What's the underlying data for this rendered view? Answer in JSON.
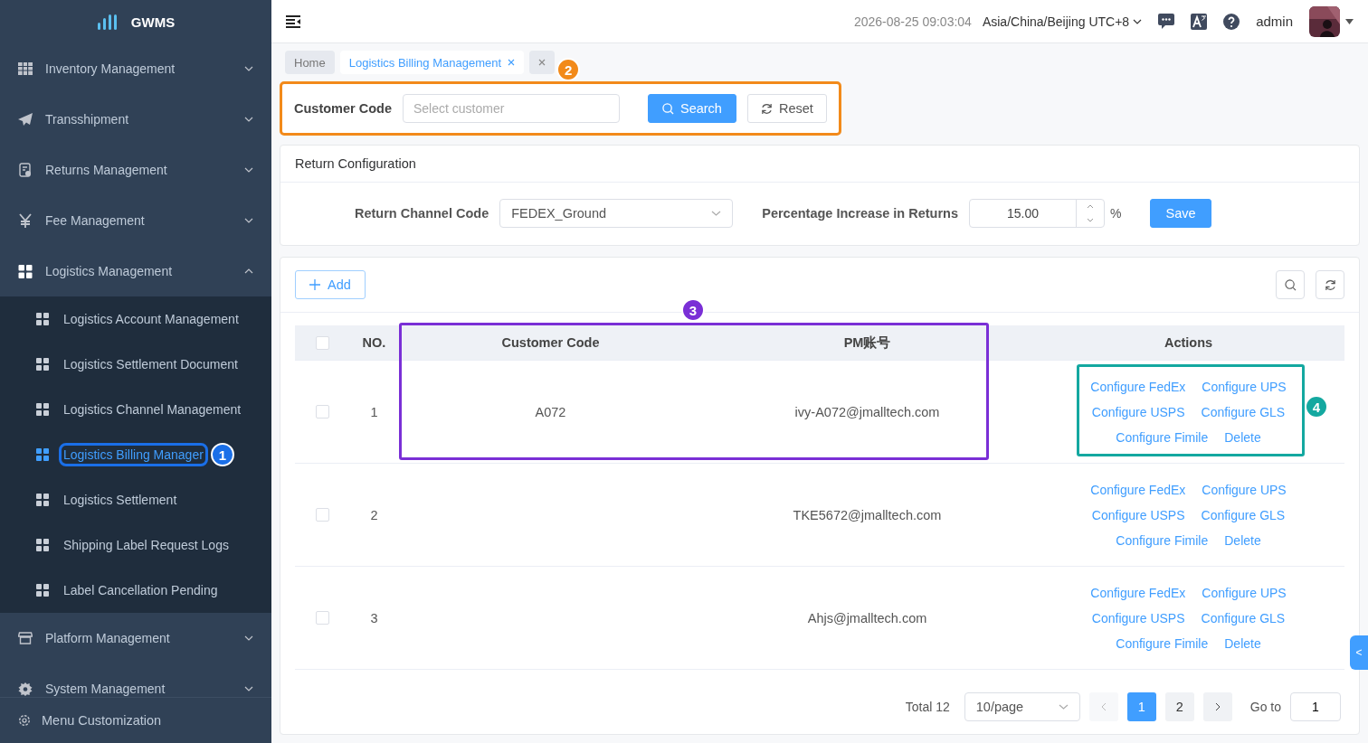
{
  "sidebar": {
    "logo": "GWMS",
    "items": [
      {
        "label": "Inventory Management",
        "expanded": false
      },
      {
        "label": "Transshipment",
        "expanded": false
      },
      {
        "label": "Returns Management",
        "expanded": false
      },
      {
        "label": "Fee Management",
        "expanded": false
      },
      {
        "label": "Logistics Management",
        "expanded": true,
        "children": [
          {
            "label": "Logistics Account Management",
            "selected": false
          },
          {
            "label": "Logistics Settlement Document",
            "selected": false
          },
          {
            "label": "Logistics Channel Management",
            "selected": false
          },
          {
            "label": "Logistics Billing Manager",
            "selected": true
          },
          {
            "label": "Logistics Settlement",
            "selected": false
          },
          {
            "label": "Shipping Label Request Logs",
            "selected": false
          },
          {
            "label": "Label Cancellation Pending",
            "selected": false
          }
        ]
      },
      {
        "label": "Platform Management",
        "expanded": false
      },
      {
        "label": "System Management",
        "expanded": false
      }
    ],
    "footer": "Menu Customization"
  },
  "header": {
    "datetime": "2026-08-25 09:03:04",
    "timezone": "Asia/China/Beijing UTC+8",
    "user": "admin"
  },
  "tabs": [
    {
      "label": "Home",
      "selected": false,
      "closable": false
    },
    {
      "label": "Logistics Billing Management",
      "selected": true,
      "closable": true
    },
    {
      "selected": false,
      "closable": true
    }
  ],
  "filter": {
    "label": "Customer Code",
    "placeholder": "Select customer",
    "search": "Search",
    "reset": "Reset"
  },
  "return_config": {
    "title": "Return Configuration",
    "channel_label": "Return Channel Code",
    "channel_value": "FEDEX_Ground",
    "percent_label": "Percentage Increase in Returns",
    "percent_value": "15.00",
    "unit": "%",
    "save": "Save"
  },
  "toolbar": {
    "add": "Add"
  },
  "table": {
    "all_checked": false,
    "columns": [
      "NO.",
      "Customer Code",
      "PM账号",
      "Actions"
    ],
    "rows": [
      {
        "checked": false,
        "no": "1",
        "customer_code": "A072",
        "pm_account": "ivy-A072@jmalltech.com",
        "actions": [
          "Configure FedEx",
          "Configure UPS",
          "Configure USPS",
          "Configure GLS",
          "Configure Fimile",
          "Delete"
        ]
      },
      {
        "checked": false,
        "no": "2",
        "pm_account": "TKE5672@jmalltech.com",
        "actions": [
          "Configure FedEx",
          "Configure UPS",
          "Configure USPS",
          "Configure GLS",
          "Configure Fimile",
          "Delete"
        ]
      },
      {
        "checked": false,
        "no": "3",
        "pm_account": "Ahjs@jmalltech.com",
        "actions": [
          "Configure FedEx",
          "Configure UPS",
          "Configure USPS",
          "Configure GLS",
          "Configure Fimile",
          "Delete"
        ]
      }
    ]
  },
  "pagination": {
    "total": "Total 12",
    "page_size": "10/page",
    "pages": [
      {
        "label": "1",
        "selected": true
      },
      {
        "label": "2",
        "selected": false
      }
    ],
    "goto_label": "Go to",
    "goto_value": "1"
  },
  "side_tab": "<",
  "annotations": [
    {
      "label": "1",
      "color": "#1a6fe8"
    },
    {
      "label": "2",
      "color": "#f28a1a"
    },
    {
      "label": "3",
      "color": "#7a2fd6"
    },
    {
      "label": "4",
      "color": "#14a8a0"
    }
  ]
}
